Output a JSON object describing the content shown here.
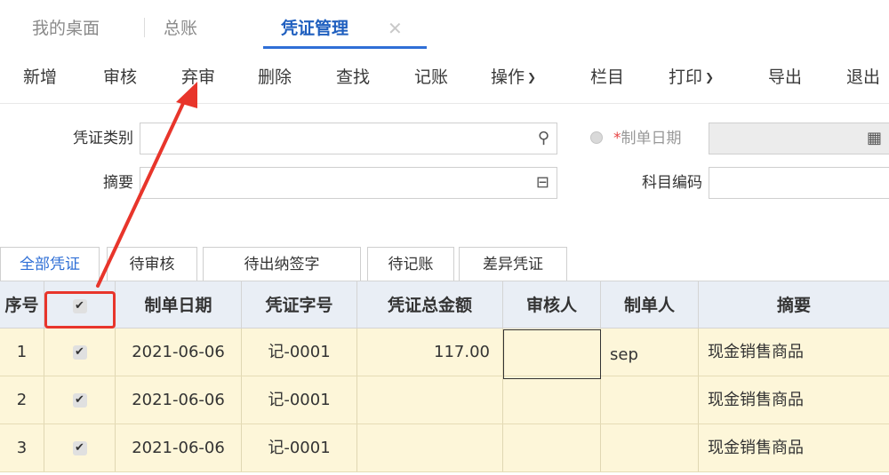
{
  "tabs": [
    {
      "label": "我的桌面"
    },
    {
      "label": "总账"
    },
    {
      "label": "凭证管理"
    }
  ],
  "toolbar": {
    "add": "新增",
    "audit": "审核",
    "abandon_audit": "弃审",
    "delete": "删除",
    "find": "查找",
    "post": "记账",
    "operate": "操作",
    "columns": "栏目",
    "print": "打印",
    "export": "导出",
    "exit": "退出"
  },
  "form": {
    "voucher_type_label": "凭证类别",
    "voucher_type_value": "",
    "summary_label": "摘要",
    "summary_value": "",
    "date_required_mark": "*",
    "date_label": "制单日期",
    "date_value": "",
    "account_code_label": "科目编码",
    "account_code_value": ""
  },
  "subtabs": [
    {
      "label": "全部凭证"
    },
    {
      "label": "待审核"
    },
    {
      "label": "待出纳签字"
    },
    {
      "label": "待记账"
    },
    {
      "label": "差异凭证"
    }
  ],
  "table": {
    "headers": {
      "seq": "序号",
      "date": "制单日期",
      "voucher_no": "凭证字号",
      "total": "凭证总金额",
      "auditor": "审核人",
      "maker": "制单人",
      "summary": "摘要"
    },
    "rows": [
      {
        "seq": "1",
        "date": "2021-06-06",
        "voucher_no": "记-0001",
        "total": "117.00",
        "auditor": "",
        "maker": "sep",
        "summary": "现金销售商品"
      },
      {
        "seq": "2",
        "date": "2021-06-06",
        "voucher_no": "记-0001",
        "total": "",
        "auditor": "",
        "maker": "",
        "summary": "现金销售商品"
      },
      {
        "seq": "3",
        "date": "2021-06-06",
        "voucher_no": "记-0001",
        "total": "",
        "auditor": "",
        "maker": "",
        "summary": "现金销售商品"
      }
    ]
  },
  "colors": {
    "accent": "#2f6fd6",
    "annotation_red": "#e8352b",
    "row_bg": "#fdf6d9",
    "header_bg": "#e9eef5"
  },
  "icons": {
    "close": "close-icon",
    "search": "search-icon",
    "reference": "reference-icon",
    "calendar": "calendar-icon",
    "chevron": "chevron-down-icon",
    "checkbox": "checkbox-checked-icon"
  }
}
